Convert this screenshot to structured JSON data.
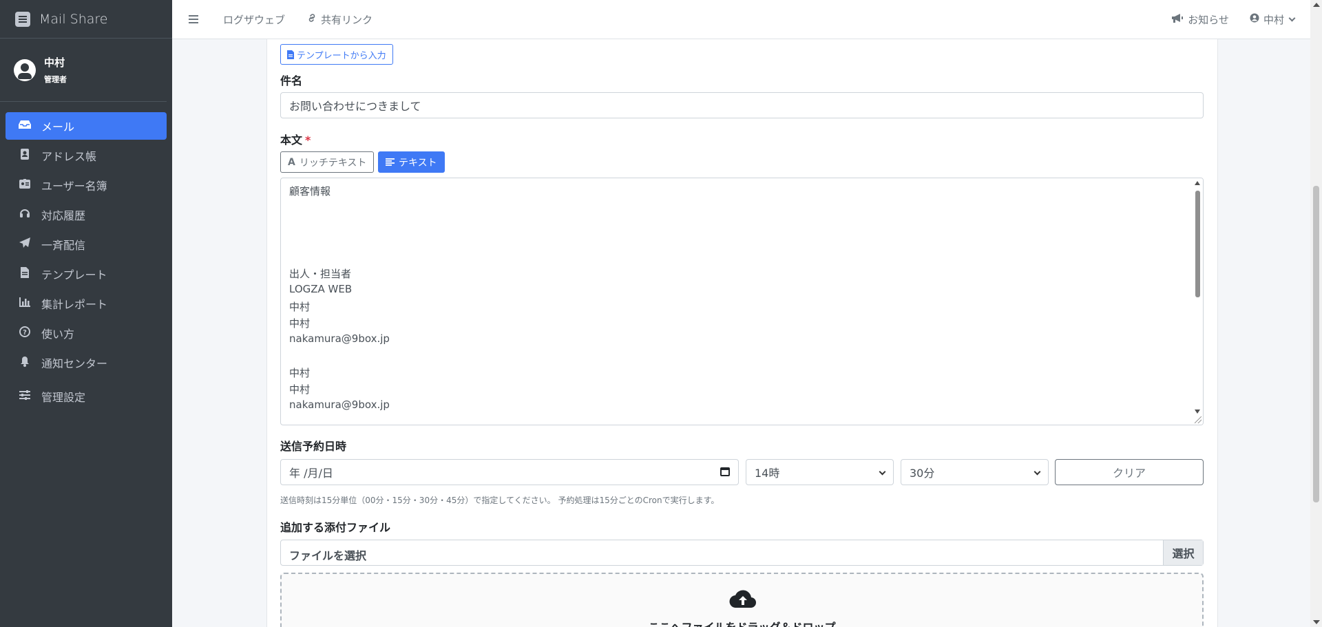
{
  "brand": {
    "name": "Mail Share"
  },
  "user": {
    "name": "中村",
    "role": "管理者"
  },
  "sidebar": {
    "items": [
      {
        "label": "メール",
        "icon": "inbox-icon",
        "active": true
      },
      {
        "label": "アドレス帳",
        "icon": "address-book-icon"
      },
      {
        "label": "ユーザー名簿",
        "icon": "id-badge-icon"
      },
      {
        "label": "対応履歴",
        "icon": "headset-icon"
      },
      {
        "label": "一斉配信",
        "icon": "paper-plane-icon"
      },
      {
        "label": "テンプレート",
        "icon": "file-icon"
      },
      {
        "label": "集計レポート",
        "icon": "bar-chart-icon"
      },
      {
        "label": "使い方",
        "icon": "question-circle-icon"
      },
      {
        "label": "通知センター",
        "icon": "bell-icon"
      },
      {
        "label": "管理設定",
        "icon": "sliders-icon"
      }
    ]
  },
  "topbar": {
    "link1": "ログザウェブ",
    "link2": "共有リンク",
    "notice": "お知らせ",
    "user": "中村"
  },
  "form": {
    "template_button": "テンプレートから入力",
    "subject_label": "件名",
    "subject_value": "お問い合わせにつきまして",
    "body_label": "本文",
    "required_mark": "*",
    "mode_rich": "リッチテキスト",
    "mode_text": "テキスト",
    "body_lines": [
      "顧客情報",
      "",
      "",
      "",
      "",
      "出人・担当者",
      "LOGZA WEB",
      "中村",
      "中村",
      "nakamura@9box.jp",
      "",
      "中村",
      "中村",
      "nakamura@9box.jp"
    ],
    "schedule_label": "送信予約日時",
    "date_placeholder": "年 /月/日",
    "hour_value": "14時",
    "minute_value": "30分",
    "clear_button": "クリア",
    "hint": "送信時刻は15分単位（00分・15分・30分・45分）で指定してください。 予約処理は15分ごとのCronで実行します。",
    "attach_label": "追加する添付ファイル",
    "file_placeholder": "ファイルを選択",
    "file_button": "選択",
    "dropzone_text": "ここへファイルをドラッグ＆ドロップ"
  }
}
